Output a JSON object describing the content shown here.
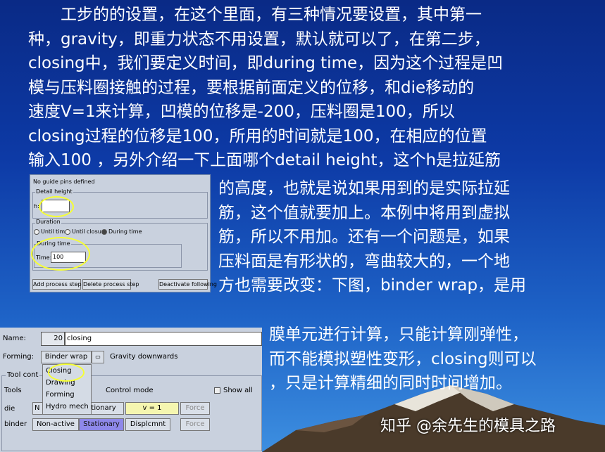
{
  "paragraph_top": [
    "　　工步的的设置，在这个里面，有三种情况要设置，其中第一",
    "种，gravity，即重力状态不用设置，默认就可以了，在第二步，",
    "closing中，我们要定义时间，即during time，因为这个过程是凹",
    "模与压料圈接触的过程，要根据前面定义的位移，和die移动的",
    "速度V=1来计算，凹模的位移是-200，压料圈是100，所以",
    "closing过程的位移是100，所用的时间就是100，在相应的位置",
    "输入100 ，另外介绍一下上面哪个detail height，这个h是拉延筋"
  ],
  "paragraph_mid": [
    "的高度，也就是说如果用到的是实际拉延",
    "筋，这个值就要加上。本例中将用到虚拟",
    "筋，所以不用加。还有一个问题是，如果",
    "压料面是有形状的，弯曲较大的，一个地",
    "方也需要改变：下图，binder wrap，是用"
  ],
  "paragraph_low": [
    "膜单元进行计算，只能计算刚弹性，",
    "而不能模拟塑性变形，closing则可以",
    "，只是计算精细的同时时间增加。"
  ],
  "watermark": "知乎 @余先生的模具之路",
  "dialog_small": {
    "top_text": "No guide pins defined",
    "detail_height_group": "Detail height",
    "h_label": "h:",
    "h_value": "",
    "duration_group": "Duration",
    "radios": [
      "Until time",
      "Until closure",
      "During time"
    ],
    "radio_selected": 2,
    "during_time_group": "During time",
    "time_label": "Time:",
    "time_value": "100",
    "buttons": [
      "Add process step ...",
      "Delete process step",
      "Deactivate following"
    ]
  },
  "dialog_big": {
    "name_label": "Name:",
    "step_number": "20",
    "name_value": "closing",
    "forming_label": "Forming:",
    "forming_value": "Binder wrap",
    "forming_dropdown_arrow": "▭",
    "gravity_label": "Gravity downwards",
    "tool_control_label": "Tool cont",
    "tools_label": "Tools",
    "control_mode_label": "Control mode",
    "show_all_label": "Show all",
    "menu_items": [
      "Closing",
      "Drawing",
      "Forming",
      "Hydro mech"
    ],
    "rows": [
      {
        "tool": "die",
        "mode_partial": "N",
        "state": "ationary",
        "value": "v = 1",
        "force": "Force"
      },
      {
        "tool": "binder",
        "mode": "Non-active",
        "state": "Stationary",
        "value": "Displcmnt",
        "force": "Force"
      }
    ]
  },
  "colors": {
    "highlight_circle": "#f6ff33",
    "selected_button": "#8e88ea",
    "value_yellow": "#f5f6b0"
  }
}
